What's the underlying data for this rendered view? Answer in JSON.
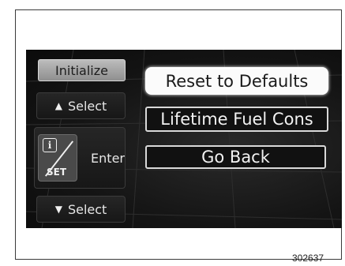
{
  "left_buttons": {
    "initialize": "Initialize",
    "select_up": "Select",
    "enter": "Enter",
    "set_icon_text": "SET",
    "select_down": "Select"
  },
  "menu": {
    "items": [
      {
        "label": "Reset to Defaults",
        "selected": true
      },
      {
        "label": "Lifetime Fuel Cons",
        "selected": false
      },
      {
        "label": "Go Back",
        "selected": false
      }
    ]
  },
  "figure_number": "302637",
  "colors": {
    "screen_bg": "#151515",
    "highlight_bg": "#fbfbfb",
    "button_bg": "#1e1e1e",
    "init_button_bg": "#a8a8a8"
  },
  "icons": [
    "up-triangle-icon",
    "info-set-icon",
    "down-triangle-icon"
  ]
}
